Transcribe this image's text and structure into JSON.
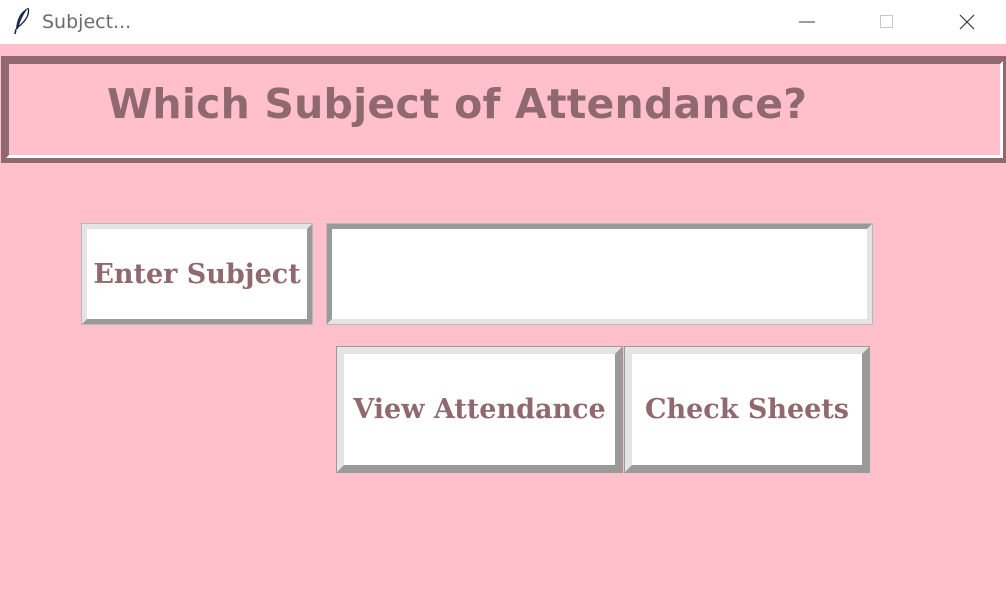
{
  "window": {
    "title": "Subject...",
    "app_icon": "feather-icon",
    "controls": {
      "minimize": "minimize-icon",
      "maximize": "maximize-icon",
      "close": "close-icon"
    }
  },
  "heading": {
    "text": "Which Subject of Attendance?"
  },
  "form": {
    "subject_label": "Enter Subject",
    "subject_value": "",
    "view_attendance_label": "View Attendance",
    "check_sheets_label": "Check Sheets"
  },
  "colors": {
    "background": "#ffc0cb",
    "text_accent": "#906970",
    "field_background": "#ffffff"
  }
}
